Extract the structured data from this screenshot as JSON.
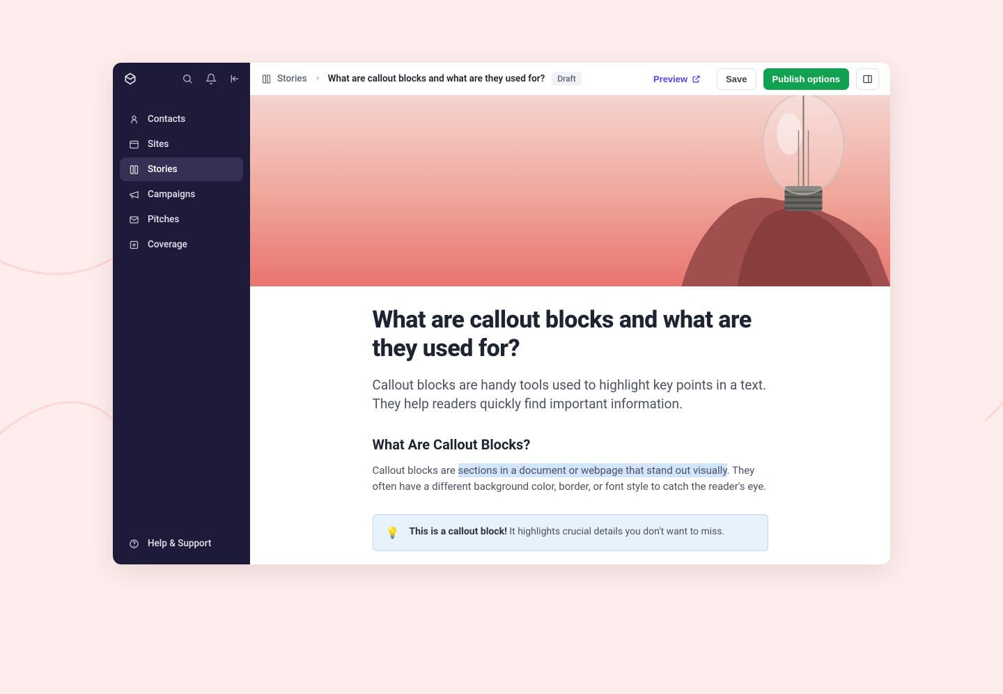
{
  "sidebar": {
    "items": [
      {
        "label": "Contacts"
      },
      {
        "label": "Sites"
      },
      {
        "label": "Stories"
      },
      {
        "label": "Campaigns"
      },
      {
        "label": "Pitches"
      },
      {
        "label": "Coverage"
      }
    ],
    "footer": {
      "label": "Help & Support"
    }
  },
  "topbar": {
    "breadcrumb_root": "Stories",
    "breadcrumb_current": "What are callout blocks and what are they used for?",
    "badge": "Draft",
    "preview": "Preview",
    "save": "Save",
    "publish": "Publish options"
  },
  "article": {
    "title": "What are callout blocks and what are they used for?",
    "lead": "Callout blocks are handy tools used to highlight key points in a text. They help readers quickly find important information.",
    "h2": "What Are Callout Blocks?",
    "body_pre": "Callout blocks are ",
    "body_highlight": "sections in a document or webpage that stand out visually",
    "body_post": ". They often have a different background color, border, or font style to catch the reader's eye.",
    "callout_emoji": "💡",
    "callout_strong": "This is a callout block!",
    "callout_rest": " It highlights crucial details you don't want to miss."
  }
}
